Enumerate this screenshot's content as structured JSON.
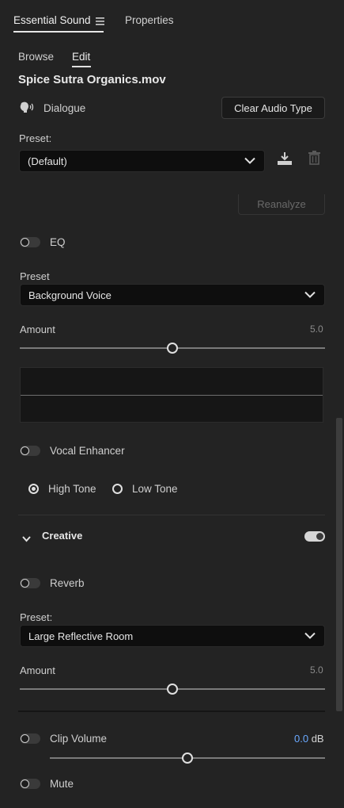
{
  "tabs": {
    "essential_sound": "Essential Sound",
    "properties": "Properties"
  },
  "subtabs": {
    "browse": "Browse",
    "edit": "Edit"
  },
  "clip_title": "Spice Sutra Organics.mov",
  "audio_type": {
    "label": "Dialogue",
    "clear_button": "Clear Audio Type"
  },
  "preset": {
    "label": "Preset:",
    "value": "(Default)"
  },
  "reanalyze_button": "Reanalyze",
  "eq": {
    "label": "EQ",
    "enabled": false,
    "preset_label": "Preset",
    "preset_value": "Background Voice",
    "amount_label": "Amount",
    "amount_value": "5.0",
    "amount_fraction": 0.5
  },
  "vocal_enhancer": {
    "label": "Vocal Enhancer",
    "enabled": false,
    "high_tone": "High Tone",
    "low_tone": "Low Tone",
    "selected": "high"
  },
  "creative": {
    "label": "Creative",
    "enabled": true,
    "reverb": {
      "label": "Reverb",
      "enabled": false,
      "preset_label": "Preset:",
      "preset_value": "Large Reflective Room",
      "amount_label": "Amount",
      "amount_value": "5.0",
      "amount_fraction": 0.5
    }
  },
  "clip_volume": {
    "label": "Clip Volume",
    "value": "0.0",
    "unit": "dB",
    "enabled": false,
    "fraction": 0.5
  },
  "mute": {
    "label": "Mute",
    "enabled": false
  },
  "colors": {
    "accent_value": "#6aa9ff",
    "background": "#232323"
  }
}
